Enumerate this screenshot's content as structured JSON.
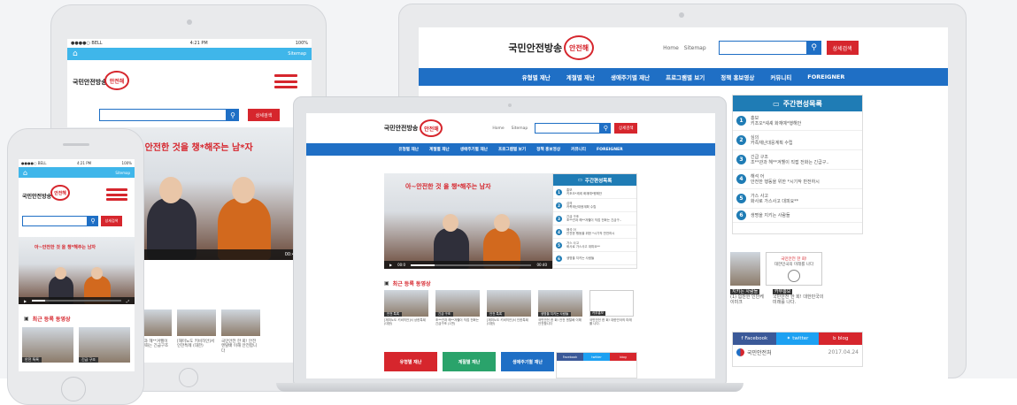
{
  "site": {
    "logo_text": "국민안전방송",
    "logo_badge": "안전해",
    "home_link": "Home",
    "sitemap_link": "Sitemap",
    "detail_search": "상세검색",
    "nav": [
      "유형별 재난",
      "계절별 재난",
      "생애주기별 재난",
      "프로그램별 보기",
      "정책 홍보영상",
      "커뮤니티",
      "FOREIGNER"
    ],
    "ranking_title": "주간편성목록",
    "ranking": [
      {
        "num": "1",
        "title": "홍보",
        "sub": "키조오*셰셰 화재예*행해안"
      },
      {
        "num": "2",
        "title": "심의",
        "sub": "카족재난대응계획 수립"
      },
      {
        "num": "3",
        "title": "긴급 구조",
        "sub": "조**관과 헤**겨헬이 직접 전화는 긴급구.."
      },
      {
        "num": "4",
        "title": "해석 어",
        "sub": "안전한 행동을 위한 *시기작 반전하시"
      },
      {
        "num": "5",
        "title": "가스 사고",
        "sub": "화사로 가스사고 대피요**"
      },
      {
        "num": "6",
        "title": "생명을 지키는 사람들",
        "sub": ""
      }
    ],
    "recent_title": "최근 등록 동영상",
    "recent_items": [
      {
        "tag": "안전 특록",
        "caption": "[재미노도 키비히안]서 상한특례 (대한)"
      },
      {
        "tag": "긴급 구조",
        "caption": "조**관과 헤**겨헬이 직접 전화는 긴급구조 (1편)"
      },
      {
        "tag": "안전 특록",
        "caption": "[재미노도 키비히안]서 인한특례 (대한)"
      },
      {
        "tag": "생명을 지키는 사람들",
        "caption": "국민안전 한 회! 안전 엔탈배 이해 안전합니다"
      },
      {
        "tag": "카부홍보",
        "caption": "국민안전 한 회! 대한민국의 미래를 나다."
      }
    ],
    "video_time": "00:40",
    "video_time_start": "00:0",
    "banners": [
      "유형별 재난",
      "계절별 재난",
      "생애주기별 재난"
    ],
    "social": {
      "facebook": "Facebook",
      "twitter": "twitter",
      "blog": "blog"
    },
    "gov_name": "국민안전처",
    "gov_date": "2017.04.24",
    "mini_captions": [
      "지키는 사람들",
      "카부홍보"
    ],
    "mini_texts": [
      "(1) 힘찬한 인안케이미크",
      "국민안전 한 회! 대한민국의 미래를 나다."
    ],
    "poster_title": "국민안전 한 회!",
    "poster_sub": "대한민국의 미래를 나다"
  },
  "video_caption": "아~안전한 것을 챙*해주는 남*자",
  "video_caption_small": "아~안전한 것 을 챙*해주는 남자",
  "tablet": {
    "status_carrier": "●●●●○ BELL",
    "status_time": "4:21 PM",
    "status_battery": "100%",
    "sitemap": "Sitemap"
  },
  "phone": {
    "status_carrier": "●●●●○ BELL",
    "status_time": "4:21 PM",
    "status_battery": "100%",
    "sitemap": "Sitemap"
  },
  "colors": {
    "primary_blue": "#1f6fc5",
    "accent_red": "#d6262d",
    "rank_blue": "#1f7cb5",
    "light_blue": "#3fb6ea"
  }
}
